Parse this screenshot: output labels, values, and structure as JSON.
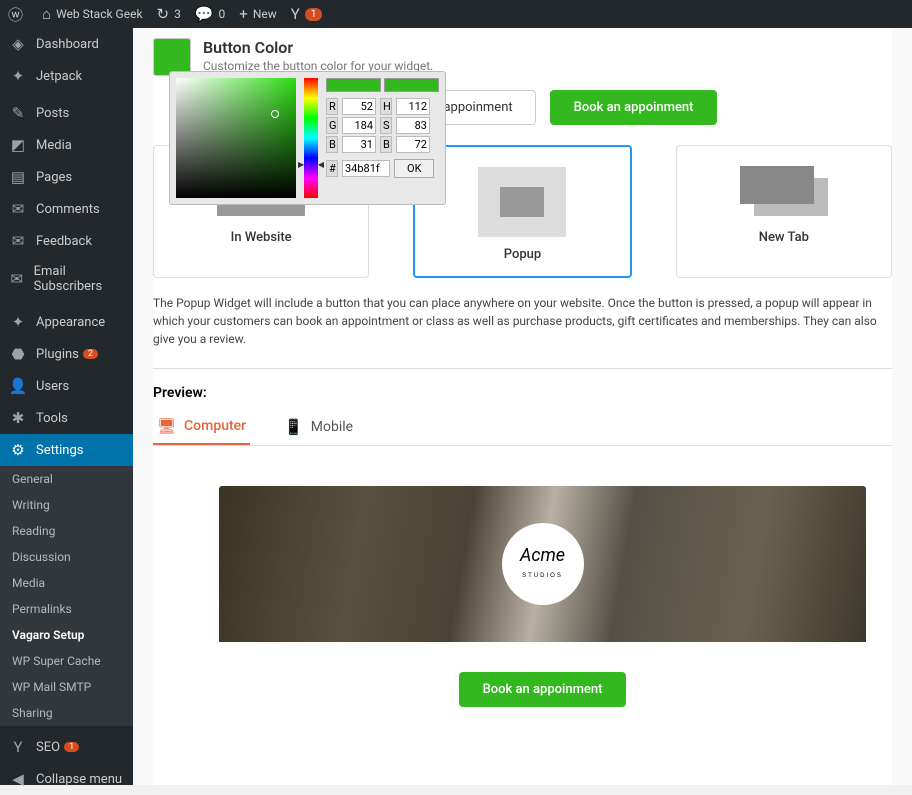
{
  "adminbar": {
    "site_name": "Web Stack Geek",
    "updates_count": "3",
    "comments_count": "0",
    "new_label": "New",
    "yoast_badge": "1"
  },
  "sidebar": {
    "items": [
      {
        "label": "Dashboard",
        "icon": "◈"
      },
      {
        "label": "Jetpack",
        "icon": "✦"
      },
      {
        "sep": true
      },
      {
        "label": "Posts",
        "icon": "✎"
      },
      {
        "label": "Media",
        "icon": "◩"
      },
      {
        "label": "Pages",
        "icon": "▤"
      },
      {
        "label": "Comments",
        "icon": "✉"
      },
      {
        "label": "Feedback",
        "icon": "✉"
      },
      {
        "label": "Email Subscribers",
        "icon": "✉"
      },
      {
        "sep": true
      },
      {
        "label": "Appearance",
        "icon": "✦"
      },
      {
        "label": "Plugins",
        "icon": "⬣",
        "badge": "2"
      },
      {
        "label": "Users",
        "icon": "👤"
      },
      {
        "label": "Tools",
        "icon": "✱"
      },
      {
        "label": "Settings",
        "icon": "⚙",
        "current": true
      }
    ],
    "submenu": [
      {
        "label": "General"
      },
      {
        "label": "Writing"
      },
      {
        "label": "Reading"
      },
      {
        "label": "Discussion"
      },
      {
        "label": "Media"
      },
      {
        "label": "Permalinks"
      },
      {
        "label": "Vagaro Setup",
        "active": true
      },
      {
        "label": "WP Super Cache"
      },
      {
        "label": "WP Mail SMTP"
      },
      {
        "label": "Sharing"
      }
    ],
    "seo_label": "SEO",
    "seo_badge": "1",
    "collapse_label": "Collapse menu"
  },
  "section": {
    "title": "Button Color",
    "desc": "Customize the button color for your widget."
  },
  "picker": {
    "r_label": "R",
    "r_val": "52",
    "g_label": "G",
    "g_val": "184",
    "b_label": "B",
    "b_val": "31",
    "h_label": "H",
    "h_val": "112",
    "s_label": "S",
    "s_val": "83",
    "v_label": "B",
    "v_val": "72",
    "hex_label": "#",
    "hex_val": "34b81f",
    "ok_label": "OK"
  },
  "buttons": {
    "outline": "an appoinment",
    "green": "Book an appoinment"
  },
  "cards": {
    "in_website": "In Website",
    "popup": "Popup",
    "new_tab": "New Tab"
  },
  "widget_desc": "The Popup Widget will include a button that you can place anywhere on your website. Once the button is pressed, a popup will appear in which your customers can book an appointment or class as well as purchase products, gift certificates and memberships. They can also give you a review.",
  "preview": {
    "label": "Preview:",
    "tab_computer": "Computer",
    "tab_mobile": "Mobile",
    "logo_line1": "Acme",
    "logo_line2": "STUDIOS",
    "button": "Book an appoinment"
  }
}
